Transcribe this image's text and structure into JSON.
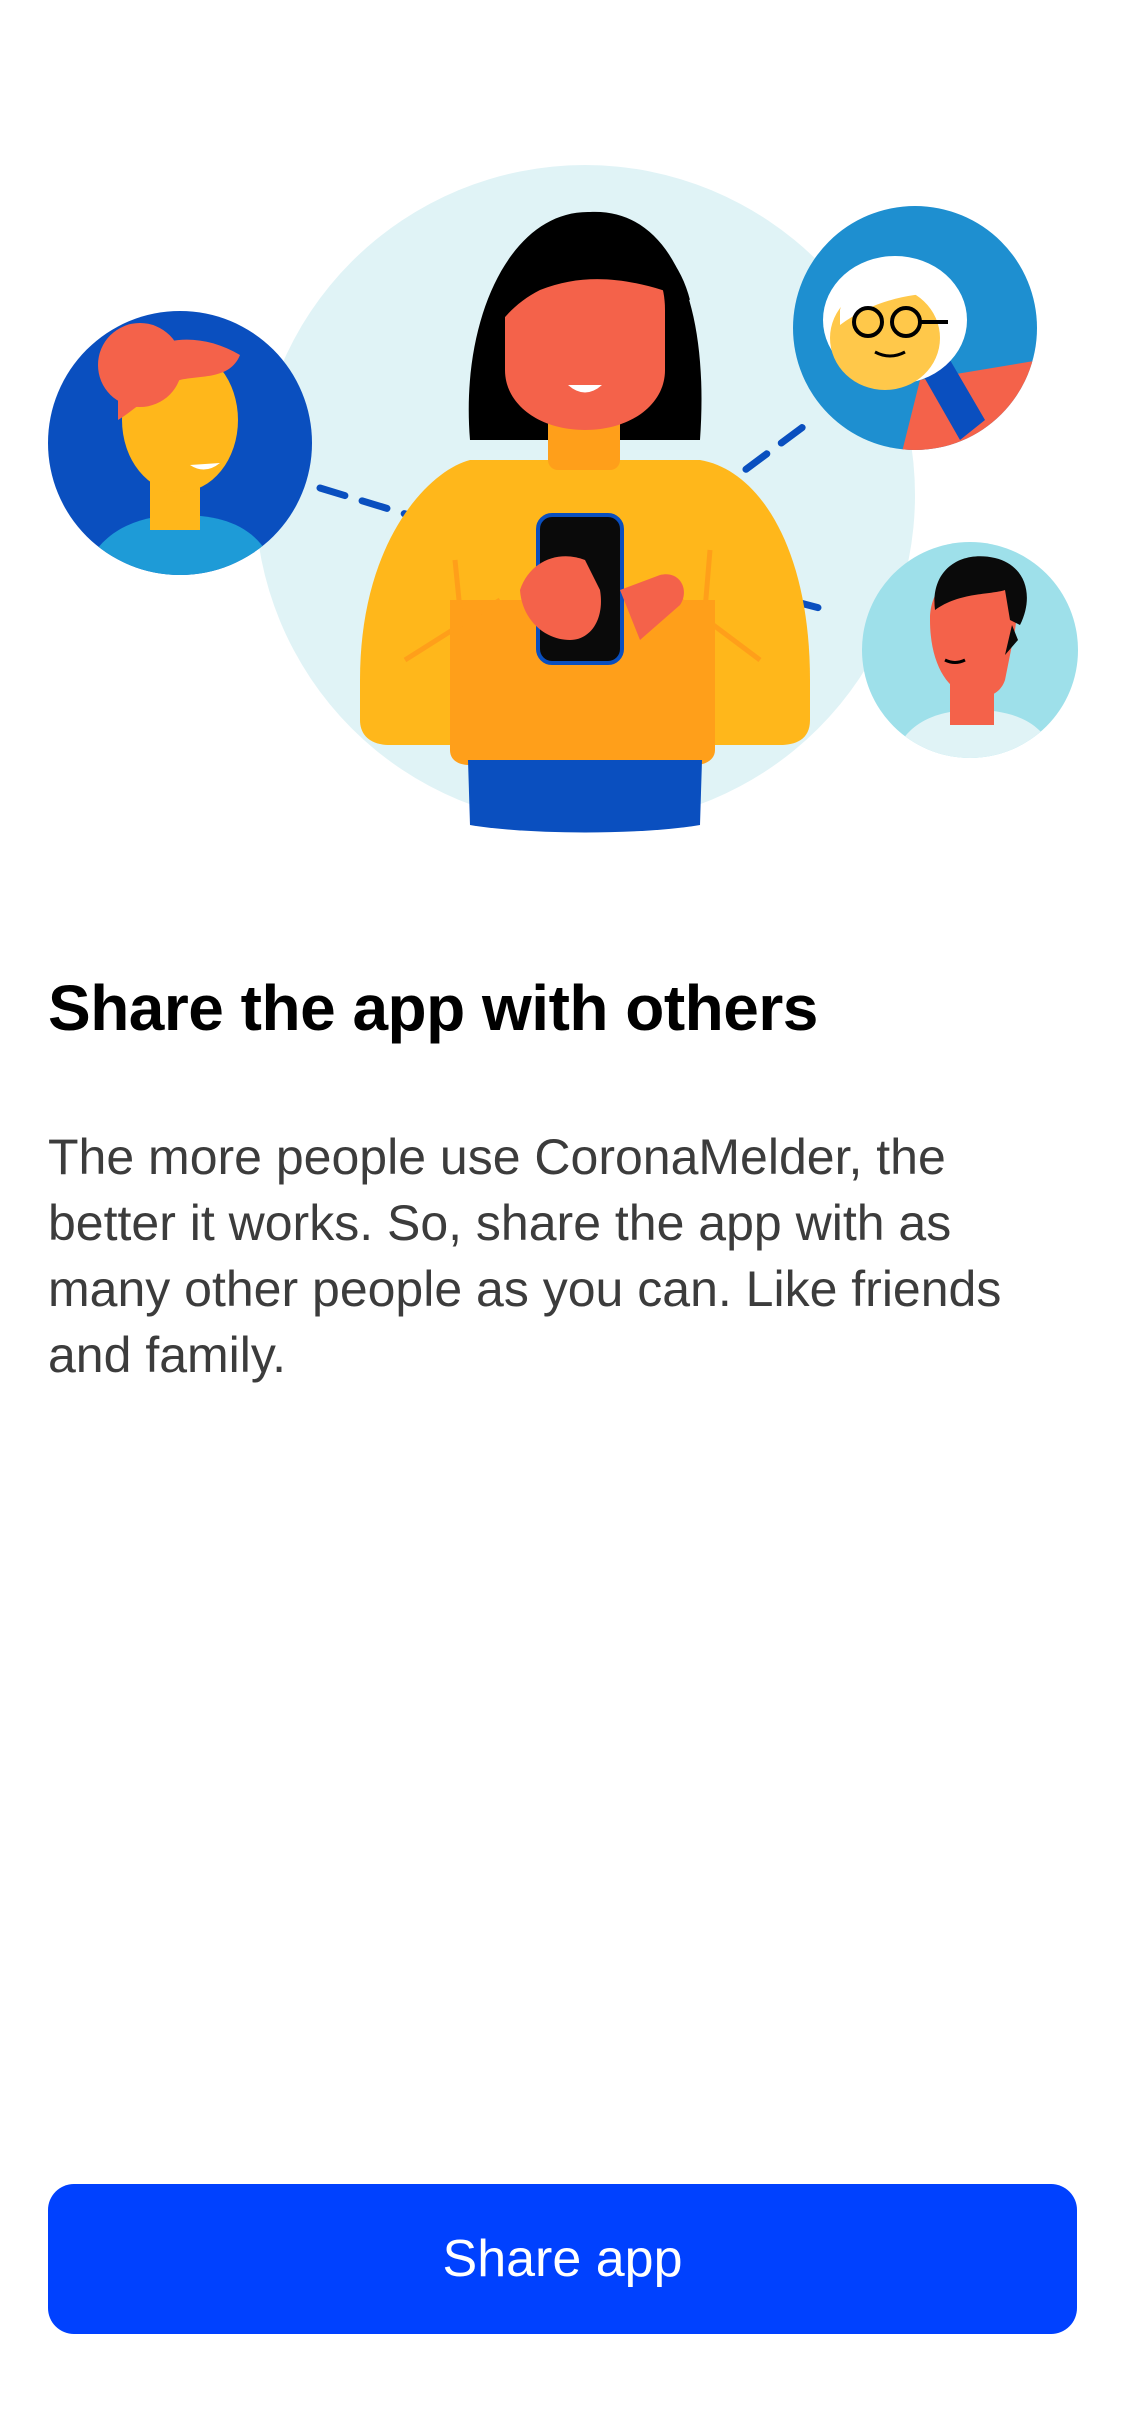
{
  "onboarding": {
    "title": "Share the app with others",
    "body": "The more people use CoronaMelder, the better it works. So, share the app with as many other people as you can. Like friends and family.",
    "primary_button_label": "Share app"
  },
  "illustration": {
    "icon": "people-sharing-illustration",
    "colors": {
      "background_circle": "#e0f3f6",
      "accent_blue": "#0a4fbf",
      "primary_button": "#0041ff",
      "sweater": "#ffb71b",
      "skin": "#f4624a"
    }
  }
}
